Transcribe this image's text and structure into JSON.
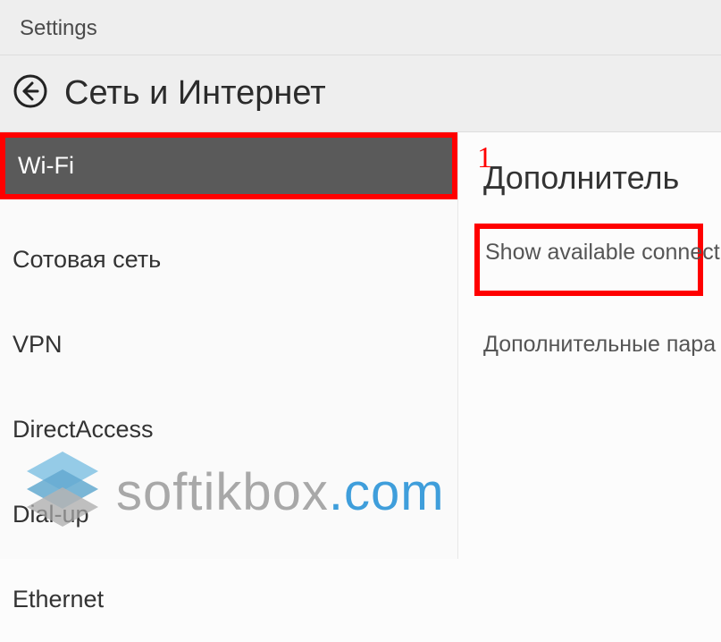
{
  "window": {
    "title": "Settings"
  },
  "header": {
    "title": "Сеть и Интернет"
  },
  "sidebar": {
    "items": {
      "0": {
        "label": "Wi-Fi"
      },
      "1": {
        "label": "Сотовая сеть"
      },
      "2": {
        "label": "VPN"
      },
      "3": {
        "label": "DirectAccess"
      },
      "4": {
        "label": "Dial-up"
      },
      "5": {
        "label": "Ethernet"
      }
    }
  },
  "content": {
    "heading": "Дополнитель",
    "link_show_connections": "Show available connect",
    "link_advanced": "Дополнительные пара"
  },
  "annotations": {
    "mark1": "1"
  },
  "watermark": {
    "part1": "softikbox",
    "part2": ".com"
  }
}
